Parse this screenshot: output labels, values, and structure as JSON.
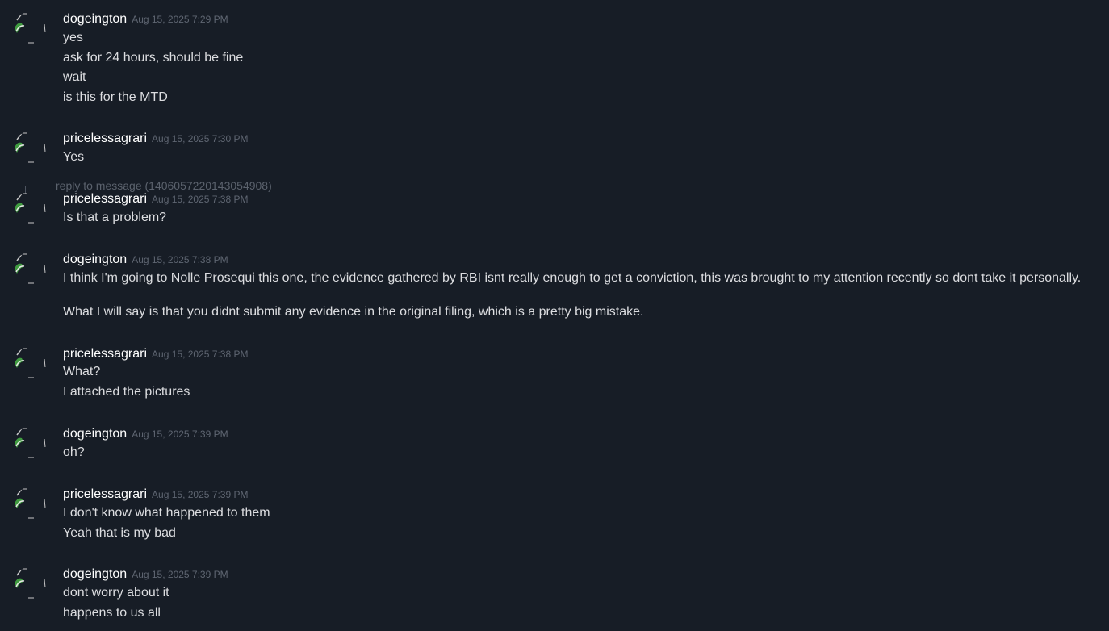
{
  "messages": [
    {
      "author": "dogeington",
      "timestamp": "Aug 15, 2025 7:29 PM",
      "lines": [
        "yes",
        "ask for 24 hours, should be fine",
        "wait",
        "is this for the MTD"
      ]
    },
    {
      "author": "pricelessagrari",
      "timestamp": "Aug 15, 2025 7:30 PM",
      "lines": [
        "Yes"
      ]
    },
    {
      "reply_to": "reply to message (1406057220143054908)",
      "author": "pricelessagrari",
      "timestamp": "Aug 15, 2025 7:38 PM",
      "lines": [
        "Is that a problem?"
      ]
    },
    {
      "author": "dogeington",
      "timestamp": "Aug 15, 2025 7:38 PM",
      "lines": [
        "I think I'm going to Nolle Prosequi this one, the evidence gathered by RBI isnt really enough to get a conviction, this was brought to my attention recently so dont take it personally.",
        "What I will say is that you didnt submit any evidence in the original filing, which is a pretty big mistake."
      ]
    },
    {
      "author": "pricelessagrari",
      "timestamp": "Aug 15, 2025 7:38 PM",
      "lines": [
        "What?",
        "I attached the pictures"
      ]
    },
    {
      "author": "dogeington",
      "timestamp": "Aug 15, 2025 7:39 PM",
      "lines": [
        "oh?"
      ]
    },
    {
      "author": "pricelessagrari",
      "timestamp": "Aug 15, 2025 7:39 PM",
      "lines": [
        "I don't know what happened to them",
        "Yeah that is my bad"
      ]
    },
    {
      "author": "dogeington",
      "timestamp": "Aug 15, 2025 7:39 PM",
      "lines": [
        "dont worry about it",
        "happens to us all"
      ]
    }
  ],
  "avatar_icon": "broken-image-icon",
  "colors": {
    "background": "#171d26",
    "author": "#ffffff",
    "text": "#dcdde0",
    "timestamp": "#5f6672",
    "reply": "#5b626d"
  }
}
